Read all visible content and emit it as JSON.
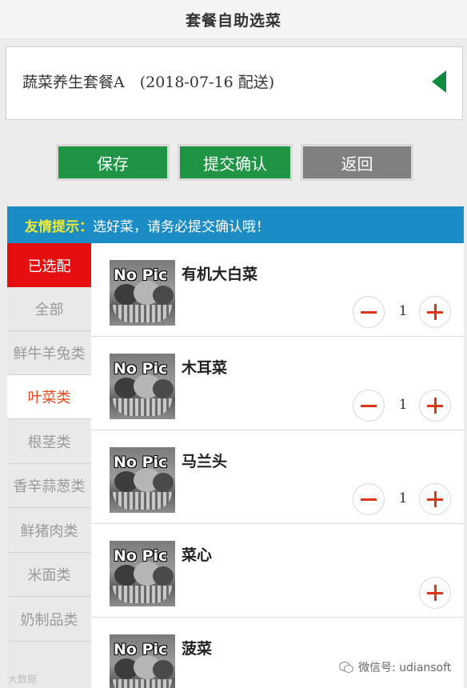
{
  "header": {
    "title": "套餐自助选菜"
  },
  "package": {
    "info": "蔬菜养生套餐A　(2018-07-16 配送)"
  },
  "actions": {
    "save": "保存",
    "submit": "提交确认",
    "back": "返回"
  },
  "tip": {
    "label": "友情提示：",
    "text": "选好菜，请务必提交确认哦！"
  },
  "categories": [
    {
      "label": "已选配"
    },
    {
      "label": "全部"
    },
    {
      "label": "鲜牛羊兔类"
    },
    {
      "label": "叶菜类"
    },
    {
      "label": "根茎类"
    },
    {
      "label": "香辛蒜葱类"
    },
    {
      "label": "鲜猪肉类"
    },
    {
      "label": "米面类"
    },
    {
      "label": "奶制品类"
    }
  ],
  "items": [
    {
      "name": "有机大白菜",
      "qty": "1",
      "image_text": "No Pic"
    },
    {
      "name": "木耳菜",
      "qty": "1",
      "image_text": "No Pic"
    },
    {
      "name": "马兰头",
      "qty": "1",
      "image_text": "No Pic"
    },
    {
      "name": "菜心",
      "qty": "",
      "image_text": "No Pic"
    },
    {
      "name": "菠菜",
      "qty": "",
      "image_text": "No Pic"
    }
  ],
  "watermark": {
    "left": "大数据",
    "right": "微信号: udiansoft"
  },
  "colors": {
    "accent_green": "#1e9444",
    "back_gray": "#808080",
    "tip_blue": "#1c8dc4",
    "tip_yellow": "#f0ea34",
    "selected_red": "#e50d0d",
    "active_orange": "#e8491d"
  },
  "icons": {
    "collapse": "triangle-left-icon",
    "decrease": "minus-icon",
    "increase": "plus-icon"
  }
}
